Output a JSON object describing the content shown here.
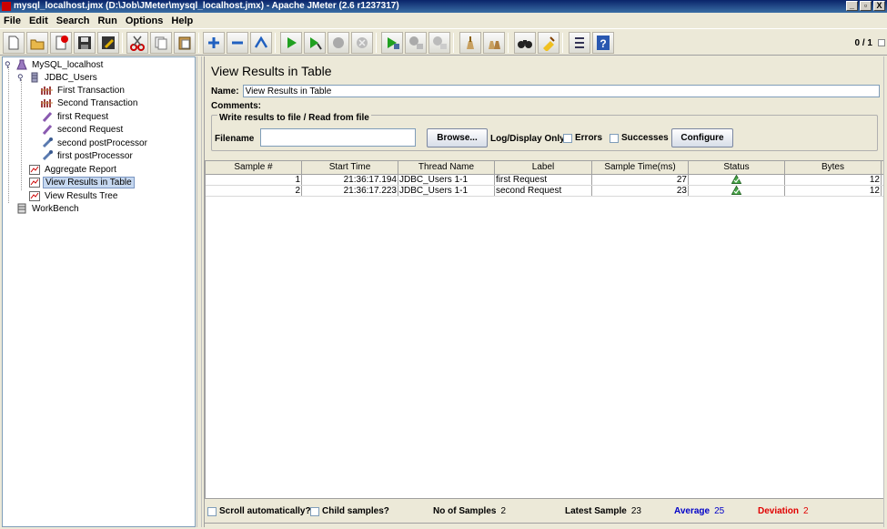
{
  "window": {
    "title": "mysql_localhost.jmx (D:\\Job\\JMeter\\mysql_localhost.jmx) - Apache JMeter (2.6 r1237317)",
    "minimize": "_",
    "maximize": "▫",
    "close": "X"
  },
  "menu": [
    "File",
    "Edit",
    "Search",
    "Run",
    "Options",
    "Help"
  ],
  "toolbar": {
    "counter": "0 / 1",
    "buttons": [
      "new-icon",
      "open-icon",
      "close-file-icon",
      "save-icon",
      "save-as-icon",
      "cut-icon",
      "copy-icon",
      "paste-icon",
      "expand-icon",
      "collapse-icon",
      "toggle-icon",
      "start-icon",
      "start-no-pauses-icon",
      "stop-icon",
      "shutdown-icon",
      "remote-start-icon",
      "remote-stop-icon",
      "remote-exit-icon",
      "clear-icon",
      "clear-all-icon",
      "search-icon",
      "reset-search-icon",
      "function-helper-icon",
      "help-icon"
    ]
  },
  "tree": {
    "items": [
      {
        "label": "MySQL_localhost",
        "icon": "test-plan-icon"
      },
      {
        "label": "JDBC_Users",
        "icon": "thread-group-icon"
      },
      {
        "label": "First Transaction",
        "icon": "transaction-controller-icon"
      },
      {
        "label": "Second Transaction",
        "icon": "transaction-controller-icon"
      },
      {
        "label": "first Request",
        "icon": "sampler-icon"
      },
      {
        "label": "second Request",
        "icon": "sampler-icon"
      },
      {
        "label": "second postProcessor",
        "icon": "post-processor-icon"
      },
      {
        "label": "first postProcessor",
        "icon": "post-processor-icon"
      },
      {
        "label": "Aggregate Report",
        "icon": "listener-icon"
      },
      {
        "label": "View Results in Table",
        "icon": "listener-icon"
      },
      {
        "label": "View Results Tree",
        "icon": "listener-icon"
      },
      {
        "label": "WorkBench",
        "icon": "workbench-icon"
      }
    ]
  },
  "panel": {
    "title": "View Results in Table",
    "name_label": "Name:",
    "name_value": "View Results in Table",
    "comments_label": "Comments:",
    "file_section_title": "Write results to file / Read from file",
    "filename_label": "Filename",
    "filename_value": "",
    "browse_label": "Browse...",
    "log_display_label": "Log/Display Only:",
    "errors_label": "Errors",
    "successes_label": "Successes",
    "configure_label": "Configure"
  },
  "table": {
    "headers": [
      "Sample #",
      "Start Time",
      "Thread Name",
      "Label",
      "Sample Time(ms)",
      "Status",
      "Bytes"
    ],
    "rows": [
      {
        "sample": "1",
        "start": "21:36:17.194",
        "thread": "JDBC_Users 1-1",
        "label": "first Request",
        "time": "27",
        "status": "success-icon",
        "bytes": "12"
      },
      {
        "sample": "2",
        "start": "21:36:17.223",
        "thread": "JDBC_Users 1-1",
        "label": "second Request",
        "time": "23",
        "status": "success-icon",
        "bytes": "12"
      }
    ]
  },
  "footer": {
    "scroll_label": "Scroll automatically?",
    "child_label": "Child samples?",
    "no_samples_label": "No of Samples",
    "no_samples_value": "2",
    "latest_label": "Latest Sample",
    "latest_value": "23",
    "average_label": "Average",
    "average_value": "25",
    "deviation_label": "Deviation",
    "deviation_value": "2",
    "average_color": "#0000c8",
    "deviation_color": "#e00000"
  }
}
